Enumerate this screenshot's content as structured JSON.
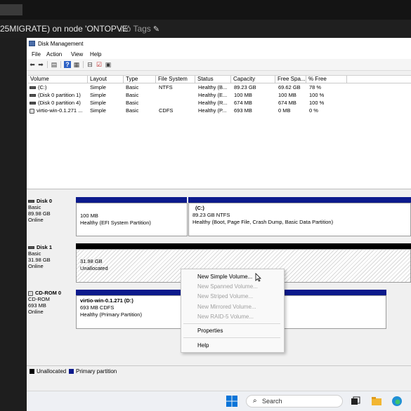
{
  "header": {
    "vm_title": "25MIGRATE) on node 'ONTOPVE'",
    "tags_label": "No Tags",
    "edit_icon": "pencil-icon"
  },
  "window": {
    "title": "Disk Management",
    "menu": [
      "File",
      "Action",
      "View",
      "Help"
    ]
  },
  "columns": [
    "Volume",
    "Layout",
    "Type",
    "File System",
    "Status",
    "Capacity",
    "Free Spa...",
    "% Free"
  ],
  "volumes": [
    {
      "volume": "(C:)",
      "layout": "Simple",
      "type": "Basic",
      "fs": "NTFS",
      "status": "Healthy (B...",
      "capacity": "89.23 GB",
      "free": "69.62 GB",
      "pct": "78 %"
    },
    {
      "volume": "(Disk 0 partition 1)",
      "layout": "Simple",
      "type": "Basic",
      "fs": "",
      "status": "Healthy (E...",
      "capacity": "100 MB",
      "free": "100 MB",
      "pct": "100 %"
    },
    {
      "volume": "(Disk 0 partition 4)",
      "layout": "Simple",
      "type": "Basic",
      "fs": "",
      "status": "Healthy (R...",
      "capacity": "674 MB",
      "free": "674 MB",
      "pct": "100 %"
    },
    {
      "volume": "virtio-win-0.1.271 ...",
      "layout": "Simple",
      "type": "Basic",
      "fs": "CDFS",
      "status": "Healthy (P...",
      "capacity": "693 MB",
      "free": "0 MB",
      "pct": "0 %"
    }
  ],
  "disks": {
    "disk0": {
      "name": "Disk 0",
      "type": "Basic",
      "size": "89.98 GB",
      "state": "Online",
      "p1_size": "100 MB",
      "p1_status": "Healthy (EFI System Partition)",
      "c_name": "(C:)",
      "c_size": "89.23 GB NTFS",
      "c_status": "Healthy (Boot, Page File, Crash Dump, Basic Data Partition)"
    },
    "disk1": {
      "name": "Disk 1",
      "type": "Basic",
      "size": "31.98 GB",
      "state": "Online",
      "seg_size": "31.98 GB",
      "seg_status": "Unallocated"
    },
    "cdrom0": {
      "name": "CD-ROM 0",
      "type": "CD-ROM",
      "size": "693 MB",
      "state": "Online",
      "vol_name": "virtio-win-0.1.271  (D:)",
      "vol_size": "693 MB CDFS",
      "vol_status": "Healthy (Primary Partition)"
    }
  },
  "context_menu": {
    "new_simple": "New Simple Volume...",
    "new_spanned": "New Spanned Volume...",
    "new_striped": "New Striped Volume...",
    "new_mirrored": "New Mirrored Volume...",
    "new_raid5": "New RAID-5 Volume...",
    "properties": "Properties",
    "help": "Help"
  },
  "legend": {
    "unallocated": "Unallocated",
    "primary": "Primary partition"
  },
  "taskbar": {
    "search_placeholder": "Search"
  },
  "colors": {
    "primary_partition": "#0c1a8c",
    "unallocated": "#000000",
    "windows_blue": "#0a74d8"
  }
}
